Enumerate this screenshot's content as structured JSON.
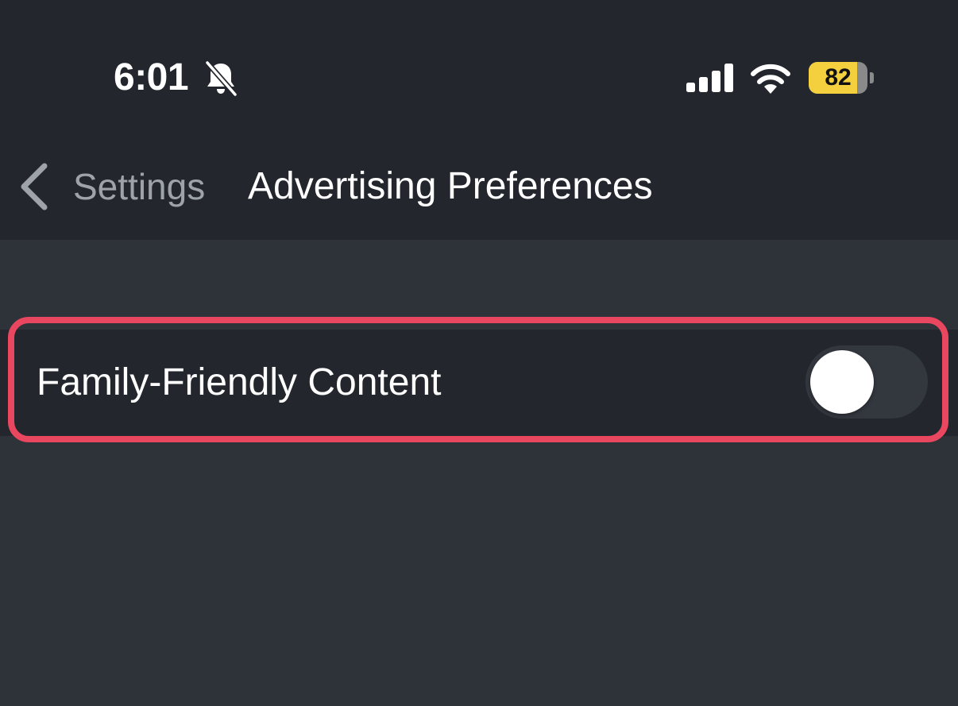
{
  "status_bar": {
    "time": "6:01",
    "silent_icon": "bell-slash-icon",
    "signal_icon": "cellular-signal-icon",
    "wifi_icon": "wifi-icon",
    "battery_level": "82",
    "battery_color": "#f4d03f"
  },
  "nav": {
    "back_icon": "chevron-left-icon",
    "back_label": "Settings",
    "title": "Advertising Preferences"
  },
  "settings": {
    "rows": [
      {
        "label": "Family-Friendly Content",
        "toggle_on": false
      }
    ]
  },
  "colors": {
    "background": "#2e3239",
    "header": "#23272d",
    "highlight": "#e8475f"
  }
}
